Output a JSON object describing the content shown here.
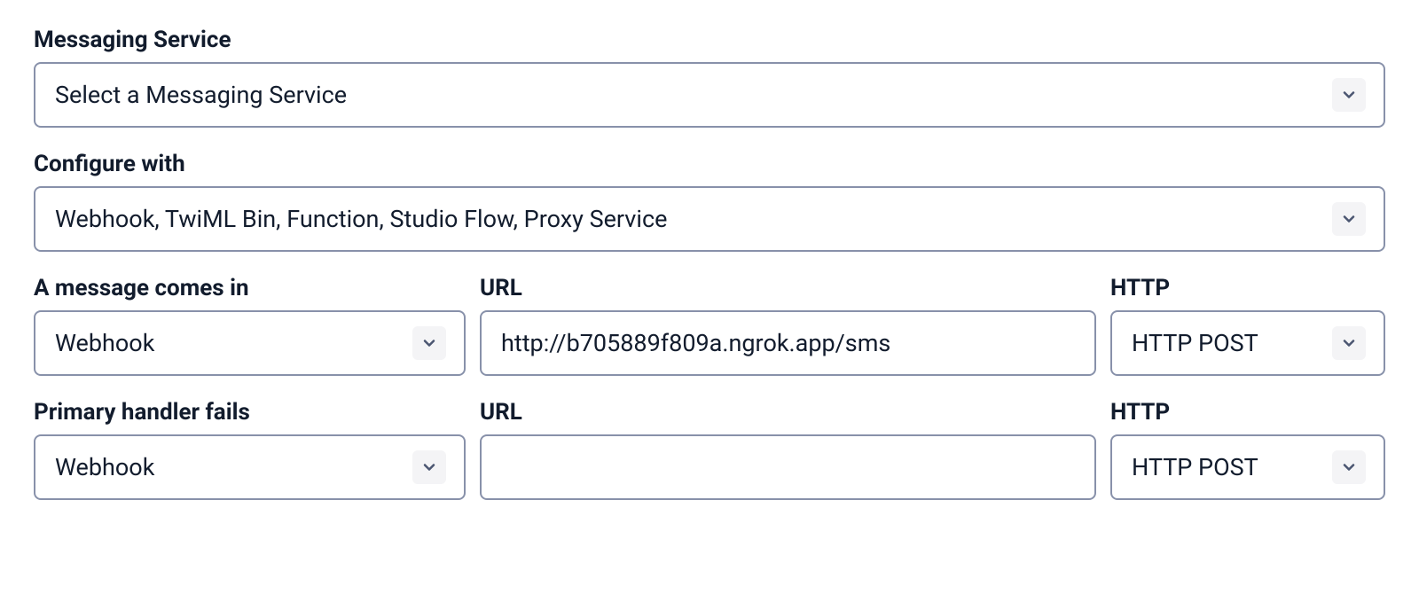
{
  "messaging_service": {
    "label": "Messaging Service",
    "value": "Select a Messaging Service"
  },
  "configure_with": {
    "label": "Configure with",
    "value": "Webhook, TwiML Bin, Function, Studio Flow, Proxy Service"
  },
  "message_comes_in": {
    "handler_label": "A message comes in",
    "handler_value": "Webhook",
    "url_label": "URL",
    "url_value": "http://b705889f809a.ngrok.app/sms",
    "http_label": "HTTP",
    "http_value": "HTTP POST"
  },
  "primary_handler_fails": {
    "handler_label": "Primary handler fails",
    "handler_value": "Webhook",
    "url_label": "URL",
    "url_value": "",
    "http_label": "HTTP",
    "http_value": "HTTP POST"
  }
}
